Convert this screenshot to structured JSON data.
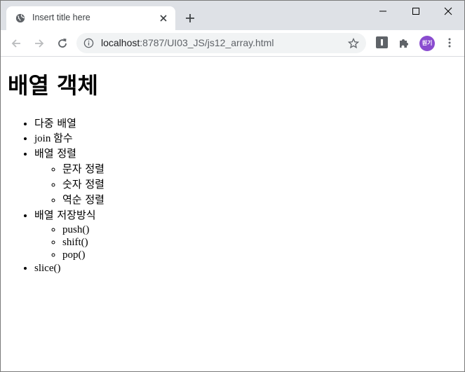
{
  "browser": {
    "tab_title": "Insert title here",
    "url_host": "localhost",
    "url_rest": ":8787/UI03_JS/js12_array.html",
    "avatar_text": "원기",
    "accent": "#8a4ccf"
  },
  "page": {
    "heading": "배열 객체",
    "items": [
      {
        "label": "다중 배열"
      },
      {
        "label": "join 함수"
      },
      {
        "label": "배열 정렬",
        "children": [
          "문자 정렬",
          "숫자 정렬",
          "역순 정렬"
        ]
      },
      {
        "label": "배열 저장방식",
        "children": [
          "push()",
          "shift()",
          "pop()"
        ]
      },
      {
        "label": "slice()"
      }
    ]
  }
}
